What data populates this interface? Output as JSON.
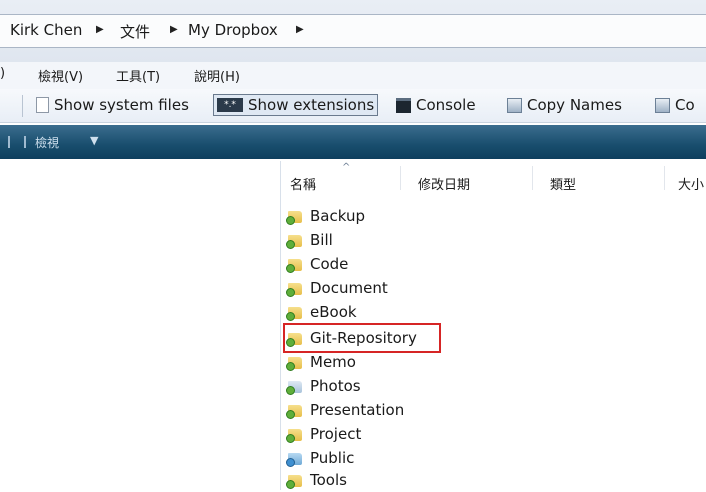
{
  "address": {
    "segments": [
      "Kirk Chen",
      "文件",
      "My Dropbox"
    ]
  },
  "menu": [
    "檢視(V)",
    "工具(T)",
    "說明(H)"
  ],
  "toolbar": {
    "show_system_files": "Show system files",
    "show_extensions": "Show extensions",
    "console": "Console",
    "copy_names": "Copy Names",
    "cut_off": "Co"
  },
  "command_bar": {
    "view_label": "檢視",
    "dropdown": "▼"
  },
  "columns": [
    "名稱",
    "修改日期",
    "類型",
    "大小"
  ],
  "files": [
    {
      "name": "Backup",
      "icon": "dropbox-folder-icon"
    },
    {
      "name": "Bill",
      "icon": "dropbox-folder-icon"
    },
    {
      "name": "Code",
      "icon": "dropbox-folder-icon"
    },
    {
      "name": "Document",
      "icon": "dropbox-folder-icon"
    },
    {
      "name": "eBook",
      "icon": "dropbox-folder-icon"
    },
    {
      "name": "Git-Repository",
      "icon": "dropbox-folder-icon"
    },
    {
      "name": "Memo",
      "icon": "dropbox-folder-icon"
    },
    {
      "name": "Photos",
      "icon": "dropbox-pictures-folder-icon"
    },
    {
      "name": "Presentation",
      "icon": "dropbox-folder-icon"
    },
    {
      "name": "Project",
      "icon": "dropbox-folder-icon"
    },
    {
      "name": "Public",
      "icon": "dropbox-public-folder-icon"
    },
    {
      "name": "Tools",
      "icon": "dropbox-folder-icon"
    }
  ],
  "highlight": {
    "item": "Git-Repository",
    "color": "#d62525"
  }
}
